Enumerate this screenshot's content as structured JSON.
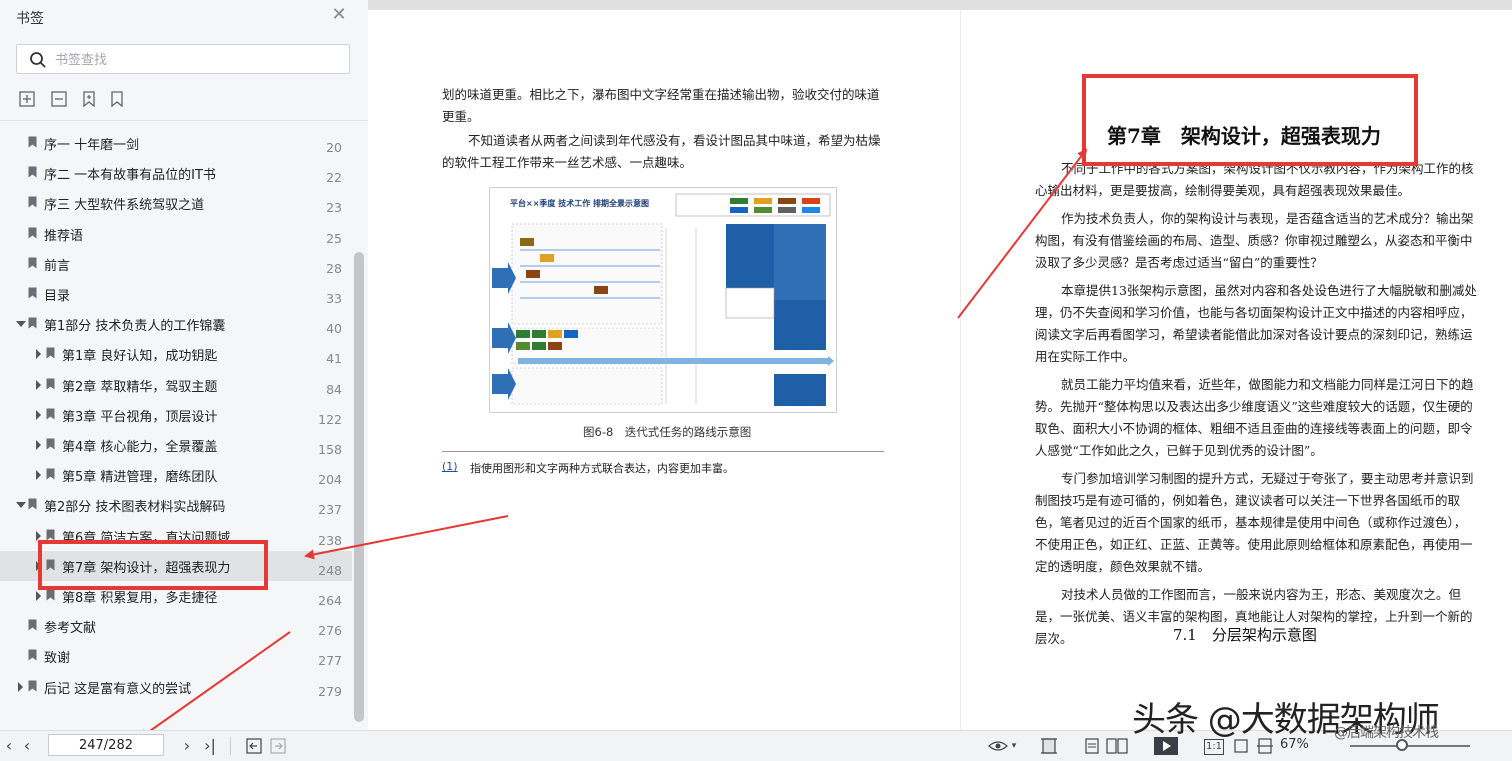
{
  "sidebar": {
    "title": "书签",
    "search_placeholder": "书签查找",
    "items": [
      {
        "label": "序一 十年磨一剑",
        "page": "20",
        "level": 0,
        "tri": "none"
      },
      {
        "label": "序二 一本有故事有品位的IT书",
        "page": "22",
        "level": 0,
        "tri": "none"
      },
      {
        "label": "序三 大型软件系统驾驭之道",
        "page": "23",
        "level": 0,
        "tri": "none"
      },
      {
        "label": "推荐语",
        "page": "25",
        "level": 0,
        "tri": "none"
      },
      {
        "label": "前言",
        "page": "28",
        "level": 0,
        "tri": "none"
      },
      {
        "label": "目录",
        "page": "33",
        "level": 0,
        "tri": "none"
      },
      {
        "label": "第1部分 技术负责人的工作锦囊",
        "page": "40",
        "level": 0,
        "tri": "expanded"
      },
      {
        "label": "第1章 良好认知，成功钥匙",
        "page": "41",
        "level": 1,
        "tri": "collapsed"
      },
      {
        "label": "第2章 萃取精华，驾驭主题",
        "page": "84",
        "level": 1,
        "tri": "collapsed"
      },
      {
        "label": "第3章 平台视角，顶层设计",
        "page": "122",
        "level": 1,
        "tri": "collapsed"
      },
      {
        "label": "第4章 核心能力，全景覆盖",
        "page": "158",
        "level": 1,
        "tri": "collapsed"
      },
      {
        "label": "第5章 精进管理，磨练团队",
        "page": "204",
        "level": 1,
        "tri": "collapsed"
      },
      {
        "label": "第2部分 技术图表材料实战解码",
        "page": "237",
        "level": 0,
        "tri": "expanded"
      },
      {
        "label": "第6章 简洁方案，直达问题域",
        "page": "238",
        "level": 1,
        "tri": "collapsed"
      },
      {
        "label": "第7章 架构设计，超强表现力",
        "page": "248",
        "level": 1,
        "tri": "collapsed",
        "selected": true
      },
      {
        "label": "第8章 积累复用，多走捷径",
        "page": "264",
        "level": 1,
        "tri": "collapsed"
      },
      {
        "label": "参考文献",
        "page": "276",
        "level": 0,
        "tri": "none"
      },
      {
        "label": "致谢",
        "page": "277",
        "level": 0,
        "tri": "none"
      },
      {
        "label": "后记 这是富有意义的尝试",
        "page": "279",
        "level": 0,
        "tri": "collapsed"
      }
    ]
  },
  "left_page": {
    "para1": "划的味道更重。相比之下，瀑布图中文字经常重在描述输出物，验收交付的味道更重。",
    "para2": "不知道读者从两者之间读到年代感没有，看设计图品其中味道，希望为枯燥的软件工程工作带来一丝艺术感、一点趣味。",
    "figure_title": "平台××季度 技术工作  排期全景示意图",
    "figure_caption": "图6-8　迭代式任务的路线示意图",
    "footnote_mark": "(1)",
    "footnote_text": "指使用图形和文字两种方式联合表达，内容更加丰富。"
  },
  "right_page": {
    "chapter_title": "第7章　架构设计，超强表现力",
    "paragraphs": [
      "不同于工作中的各式方案图，架构设计图不仅示教内容，作为架构工作的核心输出材料，更是要拔高，绘制得要美观，具有超强表现效果最佳。",
      "作为技术负责人，你的架构设计与表现，是否蕴含适当的艺术成分？输出架构图，有没有借鉴绘画的布局、造型、质感？你审视过雕塑么，从姿态和平衡中汲取了多少灵感？是否考虑过适当“留白”的重要性？",
      "本章提供13张架构示意图，虽然对内容和各处设色进行了大幅脱敏和删减处理，仍不失查阅和学习价值，也能与各切面架构设计正文中描述的内容相呼应，阅读文字后再看图学习，希望读者能借此加深对各设计要点的深刻印记，熟练运用在实际工作中。",
      "就员工能力平均值来看，近些年，做图能力和文档能力同样是江河日下的趋势。先抛开“整体构思以及表达出多少维度语义”这些难度较大的话题，仅生硬的取色、面积大小不协调的框体、粗细不适且歪曲的连接线等表面上的问题，即令人感觉“工作如此之久，已鲜于见到优秀的设计图”。",
      "专门参加培训学习制图的提升方式，无疑过于夸张了，要主动思考并意识到制图技巧是有迹可循的，例如着色，建议读者可以关注一下世界各国纸币的取色，笔者见过的近百个国家的纸币，基本规律是使用中间色（或称作过渡色），不使用正色，如正红、正蓝、正黄等。使用此原则给框体和原素配色，再使用一定的透明度，颜色效果就不错。",
      "对技术人员做的工作图而言，一般来说内容为王，形态、美观度次之。但是，一张优美、语义丰富的架构图，真地能让人对架构的掌控，上升到一个新的层次。"
    ],
    "section_title": "7.1　分层架构示意图"
  },
  "bottombar": {
    "page_value": "247/282",
    "zoom": "67%"
  },
  "watermark": {
    "text": "头条 @大数据架构师",
    "sub": "@后端架构技术栈"
  },
  "colors": {
    "annotation_red": "#e53935",
    "selected_row": "#e0e2e6"
  }
}
